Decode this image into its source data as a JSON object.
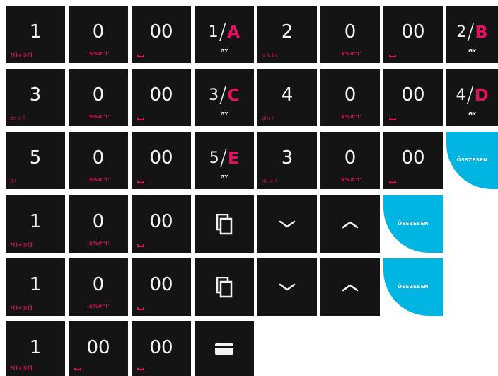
{
  "labels": {
    "one": "1",
    "two": "2",
    "three": "3",
    "four": "4",
    "five": "5",
    "zero": "0",
    "double_zero": "00",
    "slash": "/",
    "gy": "GY",
    "total": "ÖSSZESEN",
    "sub_one": "?()+@[]",
    "sub_zero": ":$%#\"!'",
    "sub_two": "a á bc",
    "sub_three": "de é f",
    "sub_four": "ghi í",
    "sub_five": "jkl",
    "letter_a": "A",
    "letter_b": "B",
    "letter_c": "C",
    "letter_d": "D",
    "letter_e": "E"
  },
  "icons": {
    "copy": "copy-icon",
    "chevron_down": "chevron-down-icon",
    "chevron_up": "chevron-up-icon",
    "card": "card-icon",
    "space": "space-icon"
  },
  "colors": {
    "key_background": "#141414",
    "accent": "#e0115f",
    "total_background": "#00b5e2"
  }
}
